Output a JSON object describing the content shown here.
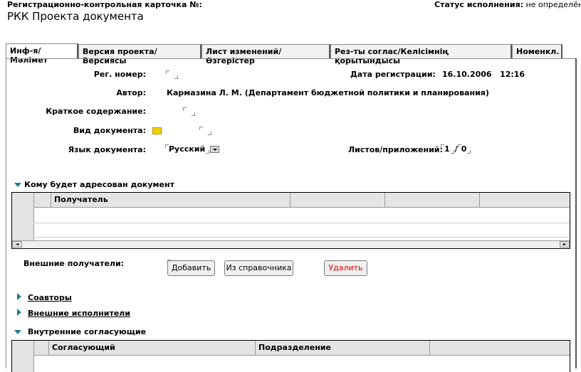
{
  "header": {
    "card_label": "Регистрационно-контрольная карточка №:",
    "status_label": "Статус исполнения:",
    "status_value": "не определён",
    "title": "РКК Проекта документа"
  },
  "tabs": [
    {
      "label": "Инф-я/Мәлімет",
      "active": true
    },
    {
      "label": "Версия проекта/Версиясы",
      "active": false
    },
    {
      "label": "Лист изменений/Өзгерістер",
      "active": false
    },
    {
      "label": "Рез-ты соглас/Келісімнің қорытындысы",
      "active": false
    },
    {
      "label": "Номенкл.",
      "active": false
    }
  ],
  "form": {
    "reg_number_label": "Рег. номер:",
    "reg_date_label": "Дата регистрации:",
    "reg_date_value": "16.10.2006   12:16",
    "author_label": "Автор:",
    "author_value": "Кармазина Л. М. (Департамент бюджетной политики и планирования)",
    "summary_label": "Краткое содержание:",
    "doc_type_label": "Вид документа:",
    "language_label": "Язык документа:",
    "language_value": "Русский",
    "sheets_label": "Листов/приложений:",
    "sheets_value": "1",
    "sheets_sep": "/",
    "attachments_value": "0"
  },
  "recipients": {
    "section_title": "Кому будет адресован документ",
    "columns": [
      "Получатель",
      "",
      "",
      ""
    ],
    "external_label": "Внешние получатели:",
    "add_button": "Добавить",
    "from_directory_button": "Из справочника",
    "delete_button": "Удалить"
  },
  "sections": {
    "coauthors": "Соавторы",
    "external_executors": "Внешние исполнители",
    "internal_approvers": "Внутренние согласующие"
  },
  "approvers_table": {
    "columns": [
      "Согласующий",
      "Подразделение",
      ""
    ]
  },
  "colors": {
    "accent_triangle": "#1d7f8f",
    "delete_text": "#e00000",
    "folder": "#f4d000"
  },
  "icons": {
    "expanded": "triangle-down-icon",
    "collapsed": "triangle-right-icon",
    "folder": "folder-icon",
    "dropdown": "dropdown-arrow-icon"
  }
}
